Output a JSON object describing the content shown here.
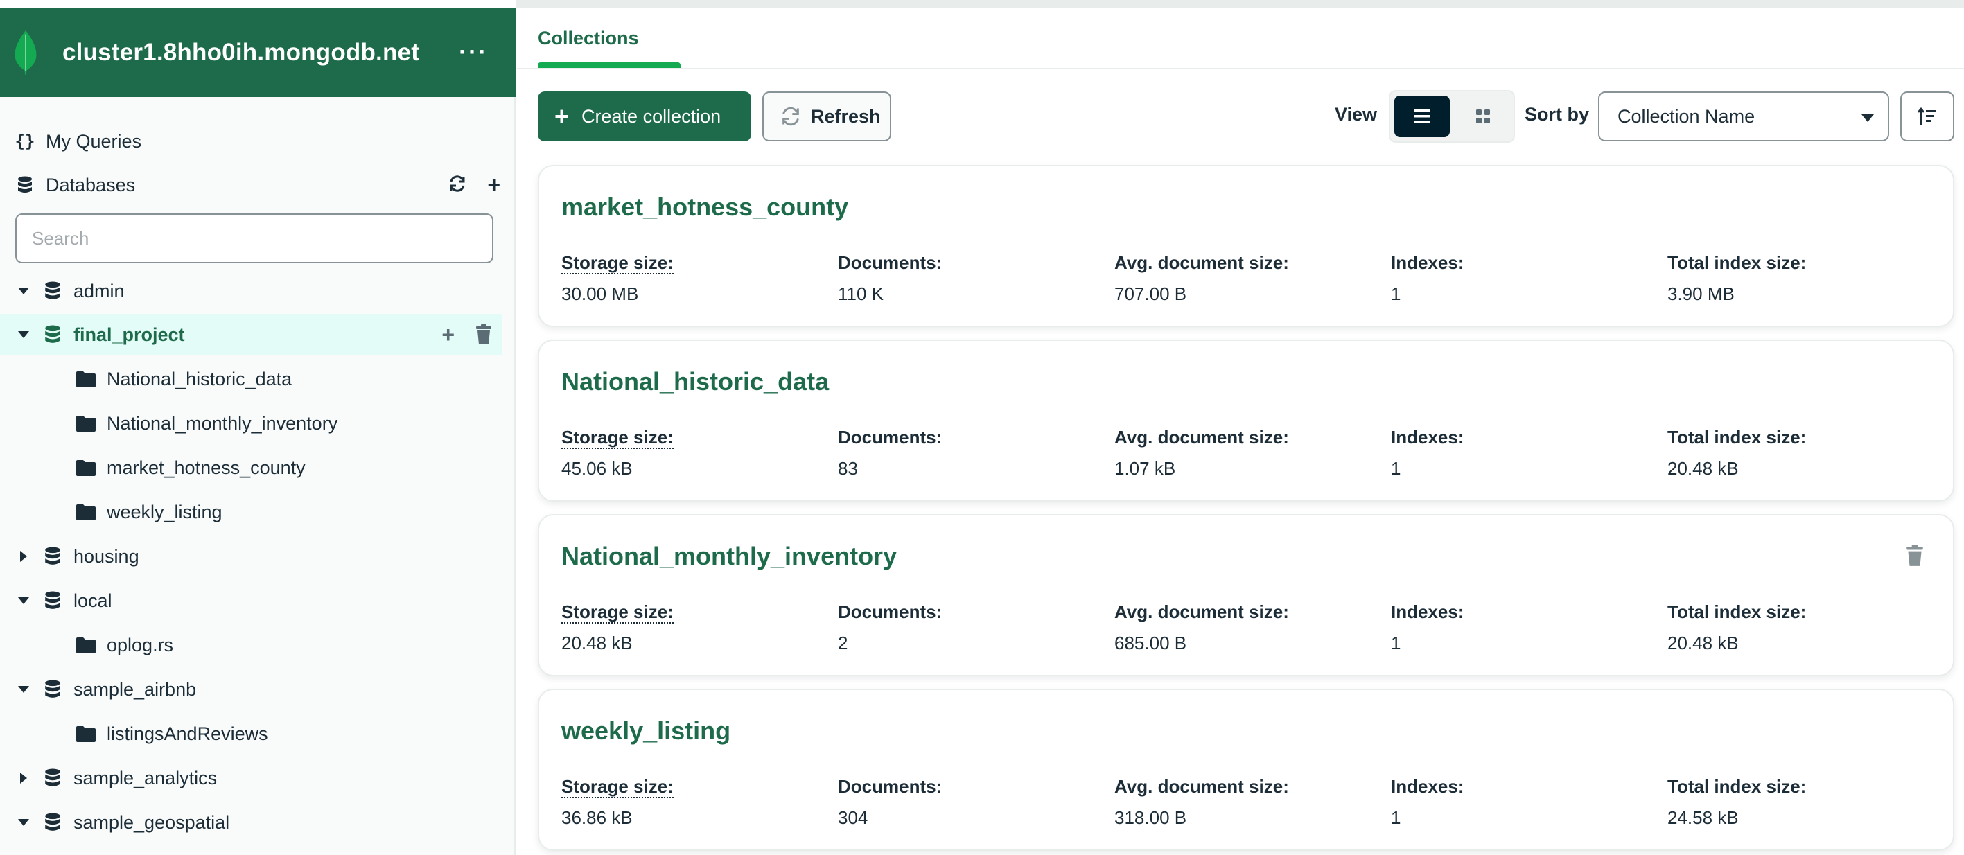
{
  "connection": {
    "name": "cluster1.8hho0ih.mongodb.net",
    "menu": "···"
  },
  "nav": {
    "my_queries": "My Queries",
    "my_queries_icon": "{}",
    "databases": "Databases"
  },
  "search": {
    "placeholder": "Search",
    "value": ""
  },
  "tree": [
    {
      "label": "admin",
      "expanded": true
    },
    {
      "label": "final_project",
      "expanded": true,
      "active": true,
      "collections": [
        "National_historic_data",
        "National_monthly_inventory",
        "market_hotness_county",
        "weekly_listing"
      ]
    },
    {
      "label": "housing",
      "expanded": false
    },
    {
      "label": "local",
      "expanded": true,
      "collections": [
        "oplog.rs"
      ]
    },
    {
      "label": "sample_airbnb",
      "expanded": true,
      "collections": [
        "listingsAndReviews"
      ]
    },
    {
      "label": "sample_analytics",
      "expanded": false
    },
    {
      "label": "sample_geospatial",
      "expanded": true
    }
  ],
  "tabs": {
    "collections": "Collections"
  },
  "toolbar": {
    "create_label": "Create collection",
    "refresh_label": "Refresh",
    "view_label": "View",
    "sortby_label": "Sort by",
    "sort_value": "Collection Name"
  },
  "stat_labels": {
    "storage": "Storage size:",
    "documents": "Documents:",
    "avg": "Avg. document size:",
    "indexes": "Indexes:",
    "total_index": "Total index size:"
  },
  "cards": [
    {
      "name": "market_hotness_county",
      "storage": "30.00 MB",
      "documents": "110 K",
      "avg": "707.00 B",
      "indexes": "1",
      "total_index": "3.90 MB"
    },
    {
      "name": "National_historic_data",
      "storage": "45.06 kB",
      "documents": "83",
      "avg": "1.07 kB",
      "indexes": "1",
      "total_index": "20.48 kB"
    },
    {
      "name": "National_monthly_inventory",
      "storage": "20.48 kB",
      "documents": "2",
      "avg": "685.00 B",
      "indexes": "1",
      "total_index": "20.48 kB",
      "hover": true
    },
    {
      "name": "weekly_listing",
      "storage": "36.86 kB",
      "documents": "304",
      "avg": "318.00 B",
      "indexes": "1",
      "total_index": "24.58 kB"
    }
  ],
  "colors": {
    "brand_dark": "#1e6b4b",
    "brand_green": "#13aa52",
    "active_row": "#e3fcf7",
    "text": "#1c2d38",
    "toggle_active": "#001e2b"
  }
}
